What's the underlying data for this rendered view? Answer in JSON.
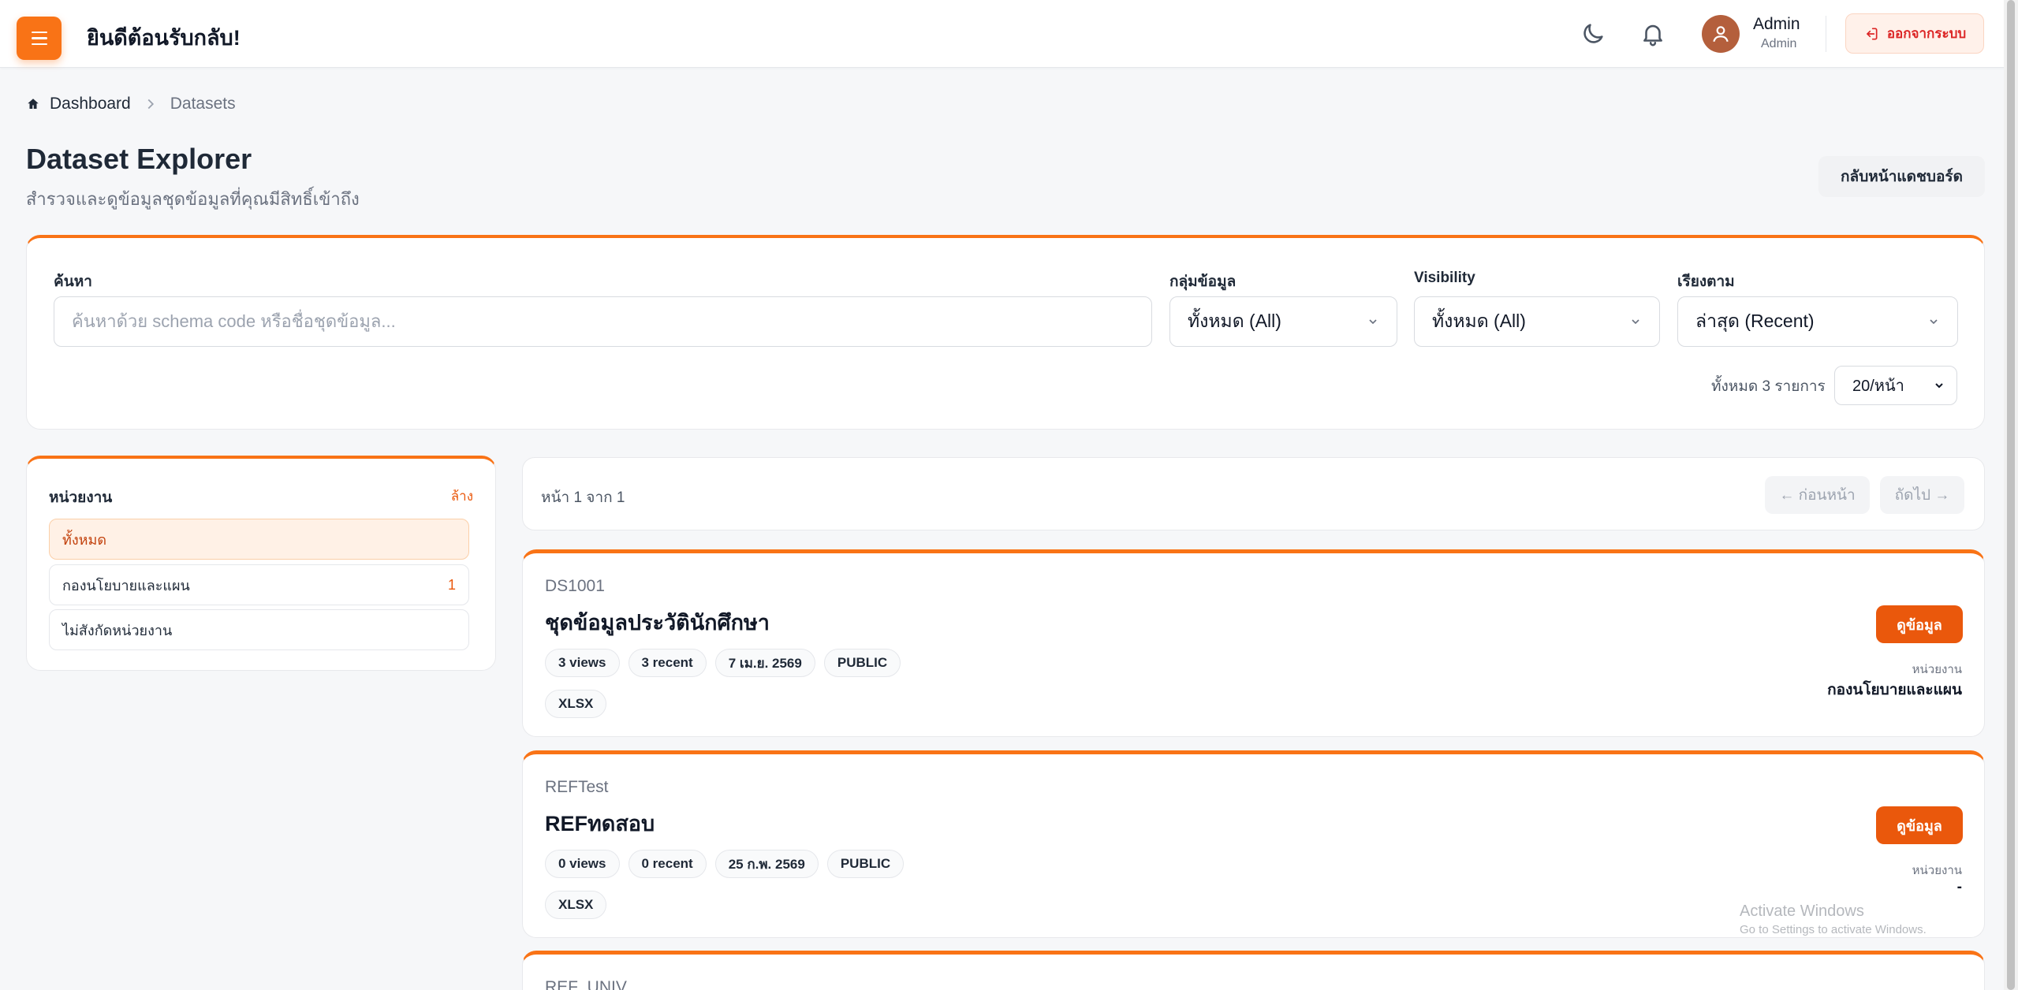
{
  "header": {
    "welcome": "ยินดีต้อนรับกลับ!",
    "user_name": "Admin",
    "user_role": "Admin",
    "logout_label": "ออกจากระบบ"
  },
  "breadcrumb": {
    "home": "Dashboard",
    "current": "Datasets"
  },
  "page": {
    "title": "Dataset Explorer",
    "subtitle": "สำรวจและดูข้อมูลชุดข้อมูลที่คุณมีสิทธิ์เข้าถึง",
    "back_label": "กลับหน้าแดชบอร์ด"
  },
  "filters": {
    "search_label": "ค้นหา",
    "search_placeholder": "ค้นหาด้วย schema code หรือชื่อชุดข้อมูล...",
    "group_label": "กลุ่มข้อมูล",
    "group_value": "ทั้งหมด (All)",
    "visibility_label": "Visibility",
    "visibility_value": "ทั้งหมด (All)",
    "sort_label": "เรียงตาม",
    "sort_value": "ล่าสุด (Recent)",
    "total_text": "ทั้งหมด 3 รายการ",
    "per_page": "20/หน้า"
  },
  "sidebar": {
    "title": "หน่วยงาน",
    "clear_label": "ล้าง",
    "items": [
      {
        "label": "ทั้งหมด",
        "count": ""
      },
      {
        "label": "กองนโยบายและแผน",
        "count": "1"
      },
      {
        "label": "ไม่สังกัดหน่วยงาน",
        "count": ""
      }
    ]
  },
  "pager": {
    "text": "หน้า 1 จาก 1",
    "prev_label": "← ก่อนหน้า",
    "next_label": "ถัดไป →"
  },
  "datasets": [
    {
      "code": "DS1001",
      "name": "ชุดข้อมูลประวัตินักศึกษา",
      "chips": [
        "3 views",
        "3 recent",
        "7 เม.ย. 2569",
        "PUBLIC"
      ],
      "format": "XLSX",
      "view_label": "ดูข้อมูล",
      "unit_label": "หน่วยงาน",
      "unit_value": "กองนโยบายและแผน"
    },
    {
      "code": "REFTest",
      "name": "REFทดสอบ",
      "chips": [
        "0 views",
        "0 recent",
        "25 ก.พ. 2569",
        "PUBLIC"
      ],
      "format": "XLSX",
      "view_label": "ดูข้อมูล",
      "unit_label": "หน่วยงาน",
      "unit_value": "-"
    },
    {
      "code": "REF_UNIV"
    }
  ],
  "watermark": {
    "line1": "Activate Windows",
    "line2": "Go to Settings to activate Windows."
  },
  "colors": {
    "accent": "#f97316",
    "button": "#ea580c",
    "danger": "#dc2626"
  }
}
